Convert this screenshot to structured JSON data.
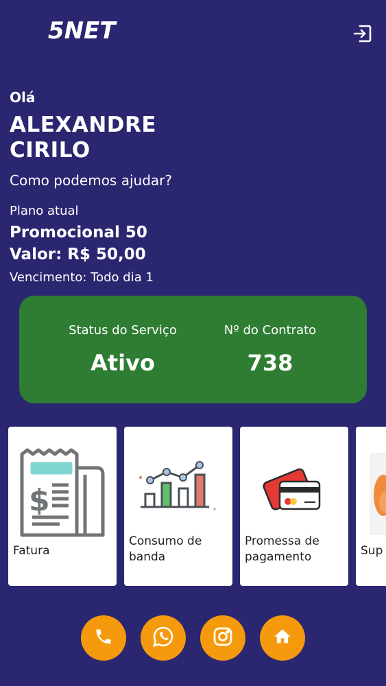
{
  "header": {
    "logo_text": "5NET",
    "logout_icon": "logout-icon"
  },
  "user": {
    "greeting": "Olá",
    "name_line1": "ALEXANDRE",
    "name_line2": "CIRILO",
    "help_text": "Como podemos ajudar?"
  },
  "plan": {
    "label": "Plano atual",
    "name": "Promocional 50",
    "value": "Valor: R$ 50,00",
    "due": "Vencimento: Todo dia 1"
  },
  "status_card": {
    "status_label": "Status do Serviço",
    "status_value": "Ativo",
    "contract_label": "Nº do Contrato",
    "contract_value": "738",
    "color": "#2e7d32"
  },
  "services": [
    {
      "label": "Fatura",
      "icon": "invoice-icon"
    },
    {
      "label": "Consumo de banda",
      "icon": "bandwidth-chart-icon"
    },
    {
      "label": "Promessa de pagamento",
      "icon": "credit-card-icon"
    },
    {
      "label": "Sup",
      "icon": "support-icon"
    }
  ],
  "fab": [
    {
      "name": "phone",
      "icon": "phone-icon"
    },
    {
      "name": "whatsapp",
      "icon": "whatsapp-icon"
    },
    {
      "name": "instagram",
      "icon": "instagram-icon"
    },
    {
      "name": "home",
      "icon": "home-icon"
    }
  ],
  "colors": {
    "background": "#2a2670",
    "accent": "#f59a0c",
    "status_green": "#2e7d32"
  }
}
